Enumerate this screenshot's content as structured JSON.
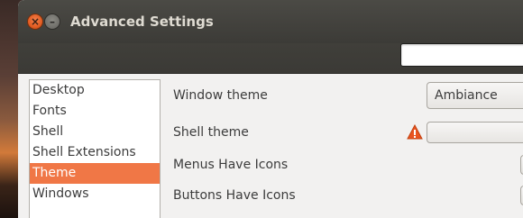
{
  "window": {
    "title": "Advanced Settings"
  },
  "sidebar": {
    "items": [
      {
        "label": "Desktop",
        "selected": false
      },
      {
        "label": "Fonts",
        "selected": false
      },
      {
        "label": "Shell",
        "selected": false
      },
      {
        "label": "Shell Extensions",
        "selected": false
      },
      {
        "label": "Theme",
        "selected": true
      },
      {
        "label": "Windows",
        "selected": false
      }
    ]
  },
  "settings": {
    "window_theme": {
      "label": "Window theme",
      "value": "Ambiance"
    },
    "shell_theme": {
      "label": "Shell theme",
      "value": ""
    },
    "menus_have_icons": {
      "label": "Menus Have Icons"
    },
    "buttons_have_icons": {
      "label": "Buttons Have Icons"
    }
  },
  "colors": {
    "accent": "#f07746",
    "titlebar": "#3c3b37",
    "warning": "#e95420"
  },
  "icons": {
    "close": "close-icon",
    "minimize": "minimize-icon",
    "warning": "warning-icon"
  }
}
